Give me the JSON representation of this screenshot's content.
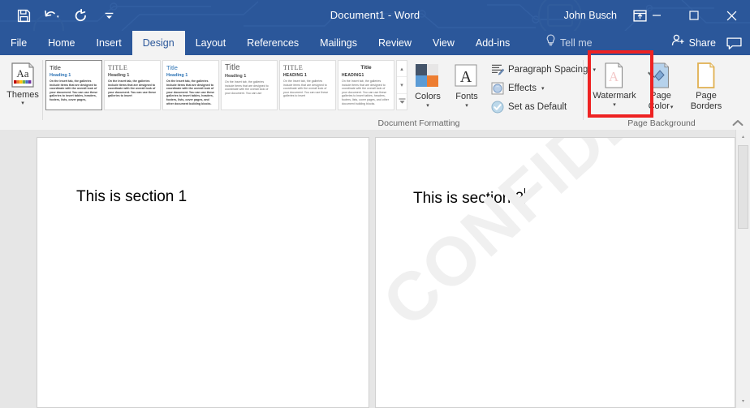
{
  "titlebar": {
    "document_title": "Document1  -  Word",
    "user_name": "John Busch",
    "quick_access": [
      {
        "name": "save",
        "label": "Save"
      },
      {
        "name": "undo",
        "label": "Undo"
      },
      {
        "name": "redo",
        "label": "Redo"
      },
      {
        "name": "customize",
        "label": "Customize Quick Access Toolbar"
      }
    ],
    "ribbon_display_options": "Ribbon Display Options",
    "minimize": "Minimize",
    "maximize": "Maximize",
    "close": "Close",
    "accent_color": "#2b579a"
  },
  "tabs": [
    {
      "label": "File",
      "active": false
    },
    {
      "label": "Home",
      "active": false
    },
    {
      "label": "Insert",
      "active": false
    },
    {
      "label": "Design",
      "active": true
    },
    {
      "label": "Layout",
      "active": false
    },
    {
      "label": "References",
      "active": false
    },
    {
      "label": "Mailings",
      "active": false
    },
    {
      "label": "Review",
      "active": false
    },
    {
      "label": "View",
      "active": false
    },
    {
      "label": "Add-ins",
      "active": false
    }
  ],
  "tellme": {
    "label": "Tell me"
  },
  "share": {
    "label": "Share"
  },
  "comments": {
    "label": "Comments"
  },
  "ribbon": {
    "groups": [
      {
        "name": "document-formatting",
        "label": "Document Formatting"
      },
      {
        "name": "page-background",
        "label": "Page Background"
      }
    ],
    "themes": {
      "label": "Themes",
      "caret": "▾"
    },
    "gallery": {
      "scroll_up": "▴",
      "scroll_down": "▾",
      "more": "▾",
      "thumbnails": [
        {
          "title": "Title",
          "heading": "Heading 1",
          "body": "On the Insert tab, the galleries include items that are designed to coordinate with the overall look of your document. You can use these galleries to insert tables, headers, footers, lists, cover pages,",
          "selected": true
        },
        {
          "title": "TITLE",
          "heading": "Heading 1",
          "body": "On the Insert tab, the galleries include items that are designed to coordinate with the overall look of your document. You can use these galleries to insert",
          "selected": false
        },
        {
          "title": "Title",
          "heading": "Heading 1",
          "body": "On the Insert tab, the galleries include items that are designed to coordinate with the overall look of your document. You can use these galleries to insert tables, headers, footers, lists, cover pages, and other document building blocks.",
          "selected": false
        },
        {
          "title": "Title",
          "heading": "Heading 1",
          "body": "On the Insert tab, the galleries include items that are designed to coordinate with the overall look of your document. You can use",
          "selected": false
        },
        {
          "title": "TITLE",
          "heading": "HEADING 1",
          "body": "On the Insert tab, the galleries include items that are designed to coordinate with the overall look of your document. You can use these galleries to insert",
          "selected": false
        },
        {
          "title": "Title",
          "heading": "HEADING1",
          "body": "On the Insert tab, the galleries include items that are designed to coordinate with the overall look of your document. You can use these galleries to insert tables, headers, footers, lists, cover pages, and other document building blocks.",
          "selected": false
        }
      ]
    },
    "colors": {
      "label": "Colors",
      "caret": "▾",
      "swatches": [
        "#44546a",
        "#e7e6e6",
        "#5b9bd5",
        "#ed7d31"
      ]
    },
    "fonts": {
      "label": "Fonts",
      "caret": "▾",
      "glyph": "A"
    },
    "paragraph_spacing": {
      "label": "Paragraph Spacing",
      "caret": "▾"
    },
    "effects": {
      "label": "Effects",
      "caret": "▾"
    },
    "set_as_default": {
      "label": "Set as Default"
    },
    "watermark": {
      "label": "Watermark",
      "caret": "▾",
      "glyph": "A"
    },
    "page_color": {
      "label_line1": "Page",
      "label_line2": "Color",
      "caret": "▾"
    },
    "page_borders": {
      "label_line1": "Page",
      "label_line2": "Borders"
    },
    "collapse": {
      "label": "Collapse the Ribbon",
      "glyph": "⌃"
    }
  },
  "annotation": {
    "color": "#ee2222",
    "target": "watermark-button"
  },
  "document": {
    "pages": [
      {
        "name": "page-1",
        "text": "This is section 1",
        "has_caret": false,
        "watermark": ""
      },
      {
        "name": "page-2",
        "text": "This is section 2",
        "has_caret": true,
        "watermark": "CONFIDENTIAL"
      }
    ]
  },
  "scrollbar": {
    "up": "▴",
    "down": "▾"
  }
}
